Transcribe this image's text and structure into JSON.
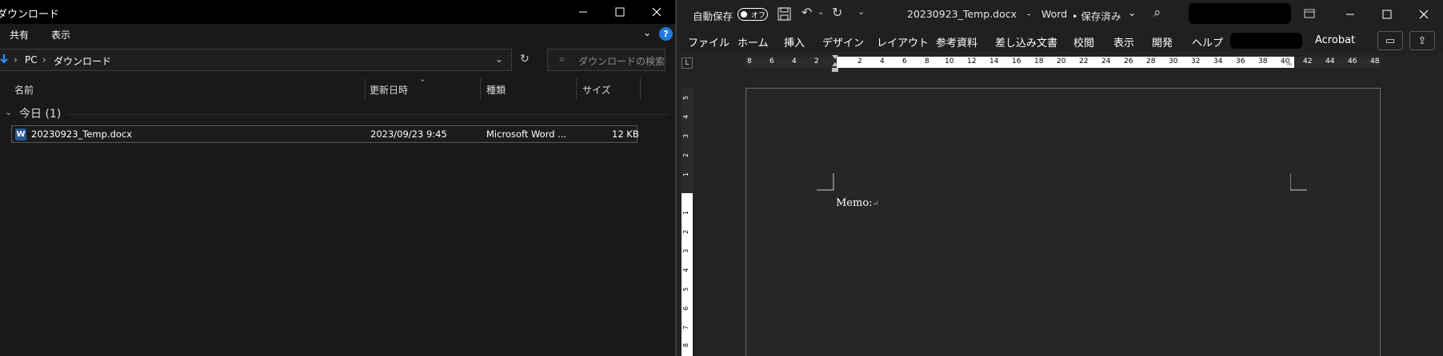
{
  "explorer": {
    "title": "ダウンロード",
    "ribbon_tabs": [
      "共有",
      "表示"
    ],
    "help_label": "?",
    "address": {
      "crumbs": [
        "PC",
        "ダウンロード"
      ]
    },
    "search": {
      "placeholder": "ダウンロードの検索"
    },
    "columns": [
      "名前",
      "更新日時",
      "種類",
      "サイズ"
    ],
    "group": {
      "label": "今日 (1)"
    },
    "files": [
      {
        "name": "20230923_Temp.docx",
        "modified": "2023/09/23 9:45",
        "type": "Microsoft Word ...",
        "size": "12 KB"
      }
    ]
  },
  "word": {
    "autosave_label": "自動保存",
    "autosave_state": "オフ",
    "title": "20230923_Temp.docx",
    "title_sep": "-",
    "app_name": "Word",
    "save_status": "• 保存済み",
    "tabs": [
      "ファイル",
      "ホーム",
      "挿入",
      "デザイン",
      "レイアウト",
      "参考資料",
      "差し込み文書",
      "校閲",
      "表示",
      "開発",
      "ヘルプ",
      "Acrobat"
    ],
    "ruler_corner": "L",
    "ruler_left_numbers": [
      "8",
      "6",
      "4",
      "2"
    ],
    "ruler_numbers": [
      "2",
      "4",
      "6",
      "8",
      "10",
      "12",
      "14",
      "16",
      "18",
      "20",
      "22",
      "24",
      "26",
      "28",
      "30",
      "32",
      "34",
      "36",
      "38",
      "40",
      "42",
      "44",
      "46",
      "48"
    ],
    "vruler_top_numbers": [
      "5",
      "4",
      "3",
      "2",
      "1"
    ],
    "vruler_numbers": [
      "1",
      "2",
      "3",
      "4",
      "5",
      "6",
      "7",
      "8"
    ],
    "document_text": "Memo:",
    "paragraph_mark": "↵"
  }
}
